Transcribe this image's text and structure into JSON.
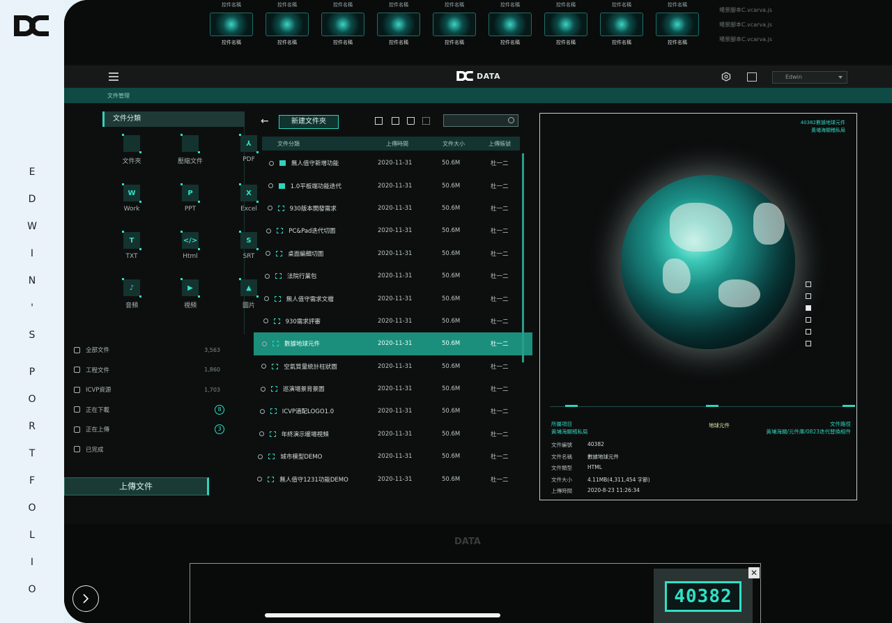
{
  "portfolio": {
    "vertical_title": [
      "E",
      "D",
      "W",
      "I",
      "N",
      "'",
      "S",
      "P",
      "O",
      "R",
      "T",
      "F",
      "O",
      "L",
      "I",
      "O"
    ]
  },
  "top_strip": {
    "thumb_caption": "控件名稱",
    "links": [
      "場景腳本C.vcarva.js",
      "場景腳本C.vcarva.js",
      "場景腳本C.vcarva.js"
    ]
  },
  "header": {
    "brand": "DATA",
    "user": "Edwin",
    "breadcrumb": "文件管理"
  },
  "categories": {
    "title": "文件分類",
    "items": [
      {
        "label": "文件夾",
        "glyph": ""
      },
      {
        "label": "壓縮文件",
        "glyph": ""
      },
      {
        "label": "PDF",
        "glyph": "⅄"
      },
      {
        "label": "Work",
        "glyph": "W"
      },
      {
        "label": "PPT",
        "glyph": "P"
      },
      {
        "label": "Excel",
        "glyph": "X"
      },
      {
        "label": "TXT",
        "glyph": "T"
      },
      {
        "label": "Html",
        "glyph": "</>"
      },
      {
        "label": "SRT",
        "glyph": "S"
      },
      {
        "label": "音頻",
        "glyph": "♪"
      },
      {
        "label": "視頻",
        "glyph": "▶"
      },
      {
        "label": "圖片",
        "glyph": "▲"
      }
    ]
  },
  "stats": [
    {
      "label": "全部文件",
      "value": "3,563"
    },
    {
      "label": "工程文件",
      "value": "1,860"
    },
    {
      "label": "ICVP資源",
      "value": "1,703"
    },
    {
      "label": "正在下載",
      "badge": "8"
    },
    {
      "label": "正在上傳",
      "badge": "3"
    },
    {
      "label": "已完成",
      "value": ""
    }
  ],
  "upload_label": "上傳文件",
  "file_panel": {
    "new_folder": "新建文件夾",
    "columns": [
      "文件分類",
      "上傳時間",
      "文件大小",
      "上傳賬號"
    ],
    "rows": [
      {
        "name": "無人值守新增功能",
        "date": "2020-11-31",
        "size": "50.6M",
        "user": "杜一二",
        "type": "folder"
      },
      {
        "name": "1.0平板端功能迭代",
        "date": "2020-11-31",
        "size": "50.6M",
        "user": "杜一二",
        "type": "folder"
      },
      {
        "name": "930版本開發需求",
        "date": "2020-11-31",
        "size": "50.6M",
        "user": "杜一二",
        "type": "file"
      },
      {
        "name": "PC&Pad迭代切圖",
        "date": "2020-11-31",
        "size": "50.6M",
        "user": "杜一二",
        "type": "file"
      },
      {
        "name": "桌面編輯切圖",
        "date": "2020-11-31",
        "size": "50.6M",
        "user": "杜一二",
        "type": "file"
      },
      {
        "name": "法院行業包",
        "date": "2020-11-31",
        "size": "50.6M",
        "user": "杜一二",
        "type": "file"
      },
      {
        "name": "無人值守需求文檔",
        "date": "2020-11-31",
        "size": "50.6M",
        "user": "杜一二",
        "type": "file"
      },
      {
        "name": "930需求評審",
        "date": "2020-11-31",
        "size": "50.6M",
        "user": "杜一二",
        "type": "file"
      },
      {
        "name": "數據地球元件",
        "date": "2020-11-31",
        "size": "50.6M",
        "user": "杜一二",
        "type": "file",
        "selected": true
      },
      {
        "name": "空氣質量統計柱狀圖",
        "date": "2020-11-31",
        "size": "50.6M",
        "user": "杜一二",
        "type": "file"
      },
      {
        "name": "巡演場景背景圖",
        "date": "2020-11-31",
        "size": "50.6M",
        "user": "杜一二",
        "type": "file"
      },
      {
        "name": "ICVP適配LOGO1.0",
        "date": "2020-11-31",
        "size": "50.6M",
        "user": "杜一二",
        "type": "file"
      },
      {
        "name": "年終演示暖場視頻",
        "date": "2020-11-31",
        "size": "50.6M",
        "user": "杜一二",
        "type": "file"
      },
      {
        "name": "城市模型DEMO",
        "date": "2020-11-31",
        "size": "50.6M",
        "user": "杜一二",
        "type": "file"
      },
      {
        "name": "無人值守1231功能DEMO",
        "date": "2020-11-31",
        "size": "50.6M",
        "user": "杜一二",
        "type": "file"
      }
    ]
  },
  "preview": {
    "top_right": [
      "40382數據地球元件",
      "黃埔海關稽私局"
    ],
    "project_label": "所屬項目",
    "project_value": "黃埔海關稽私局",
    "center_tag": "地球元件",
    "path_label": "文件路徑",
    "path_value": "黃埔海關/元件庫/0823迭代替換組件",
    "info": [
      {
        "k": "文件編號",
        "v": "40382"
      },
      {
        "k": "文件名稱",
        "v": "數據地球元件"
      },
      {
        "k": "文件類型",
        "v": "HTML"
      },
      {
        "k": "文件大小",
        "v": "4.11MB(4,311,454 字節)"
      },
      {
        "k": "上傳時間",
        "v": "2020-8-23    11:26:34"
      }
    ]
  },
  "bottom": {
    "brand": "DATA",
    "code": "40382"
  },
  "colors": {
    "accent": "#2fd4bd",
    "background": "#0d0f0f",
    "selected_row": "#1c8f7c"
  }
}
